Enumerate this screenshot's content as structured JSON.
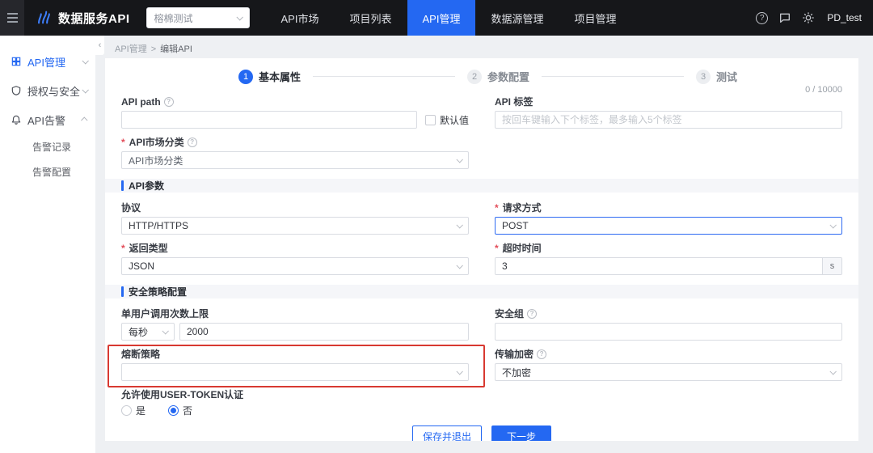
{
  "topbar": {
    "brand": "数据服务API",
    "workspace": "榕棉测试",
    "nav": [
      {
        "label": "API市场",
        "active": false
      },
      {
        "label": "项目列表",
        "active": false
      },
      {
        "label": "API管理",
        "active": true
      },
      {
        "label": "数据源管理",
        "active": false
      },
      {
        "label": "项目管理",
        "active": false
      }
    ],
    "username": "PD_test"
  },
  "icons": {
    "collapse": "‹",
    "help": "?",
    "info": "?"
  },
  "sidebar": {
    "items": [
      {
        "label": "API管理",
        "active": true
      },
      {
        "label": "授权与安全",
        "active": false
      },
      {
        "label": "API告警",
        "active": false,
        "expanded": true
      }
    ],
    "sub_items": [
      {
        "label": "告警记录"
      },
      {
        "label": "告警配置"
      }
    ]
  },
  "breadcrumb": {
    "parent": "API管理",
    "separator": ">",
    "current": "编辑API"
  },
  "stepper": {
    "steps": [
      {
        "num": "1",
        "label": "基本属性",
        "active": true
      },
      {
        "num": "2",
        "label": "参数配置",
        "active": false
      },
      {
        "num": "3",
        "label": "测试",
        "active": false
      }
    ]
  },
  "counter": "0 / 10000",
  "form": {
    "api_path": {
      "label": "API path",
      "value": "",
      "checkbox_label": "默认值",
      "checkbox_checked": false
    },
    "api_tag": {
      "label": "API 标签",
      "value": "",
      "placeholder": "按回车键输入下个标签，最多输入5个标签"
    },
    "api_market": {
      "label": "API市场分类",
      "value": "API市场分类",
      "required": true
    },
    "sections": {
      "params": "API参数",
      "security": "安全策略配置"
    },
    "protocol": {
      "label": "协议",
      "value": "HTTP/HTTPS"
    },
    "method": {
      "label": "请求方式",
      "value": "POST",
      "required": true
    },
    "return_type": {
      "label": "返回类型",
      "value": "JSON",
      "required": true
    },
    "timeout": {
      "label": "超时时间",
      "value": "3",
      "suffix": "s",
      "required": true
    },
    "rate_limit": {
      "label": "单用户调用次数上限",
      "unit": "每秒",
      "value": "2000"
    },
    "security_group": {
      "label": "安全组",
      "value": ""
    },
    "circuit_breaker": {
      "label": "熔断策略",
      "value": "",
      "annotated": true
    },
    "encryption": {
      "label": "传输加密",
      "value": "不加密"
    },
    "user_token": {
      "label": "允许使用USER-TOKEN认证",
      "options": [
        {
          "label": "是",
          "checked": false
        },
        {
          "label": "否",
          "checked": true
        }
      ]
    }
  },
  "footer": {
    "save_exit": "保存并退出",
    "next": "下一步"
  }
}
